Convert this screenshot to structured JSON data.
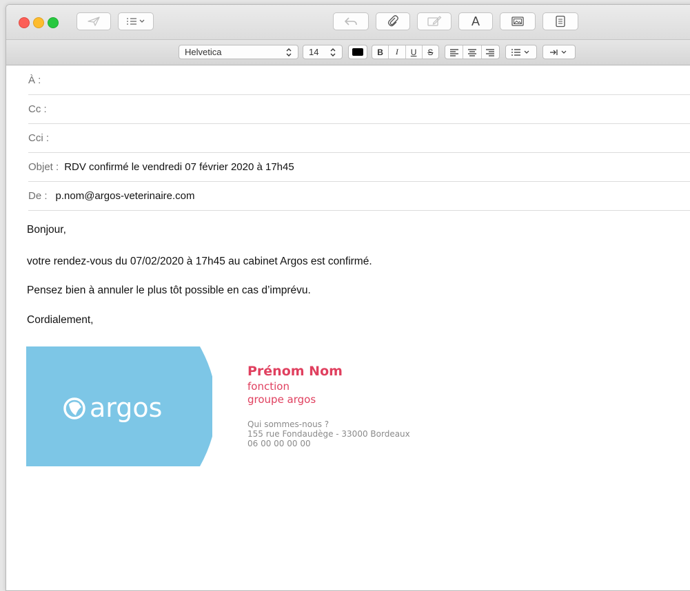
{
  "toolbar": {
    "format_label": "A"
  },
  "format": {
    "font_family": "Helvetica",
    "font_size": "14",
    "bold": "B",
    "italic": "I",
    "underline": "U",
    "strike": "S",
    "text_color": "#000000"
  },
  "headers": {
    "to_label": "À :",
    "to_value": "",
    "cc_label": "Cc :",
    "cc_value": "",
    "bcc_label": "Cci :",
    "bcc_value": "",
    "subject_label": "Objet :",
    "subject_value": "RDV confirmé le vendredi 07 février 2020 à 17h45",
    "from_label": "De :",
    "from_value": "p.nom@argos-veterinaire.com"
  },
  "body": {
    "greeting": "Bonjour,",
    "line1": "votre rendez-vous du 07/02/2020 à 17h45 au cabinet Argos est confirmé.",
    "line2": "Pensez bien à annuler le plus tôt possible en cas d’imprévu.",
    "closing": "Cordialement,"
  },
  "signature": {
    "logo_text": "argos",
    "name": "Prénom Nom",
    "role": "fonction",
    "company": "groupe argos",
    "about": "Qui sommes-nous ?",
    "address": "155 rue Fondaudège - 33000 Bordeaux",
    "phone": "06 00 00 00 00",
    "logo_color": "#7dc6e6",
    "accent_color": "#e0405f"
  }
}
